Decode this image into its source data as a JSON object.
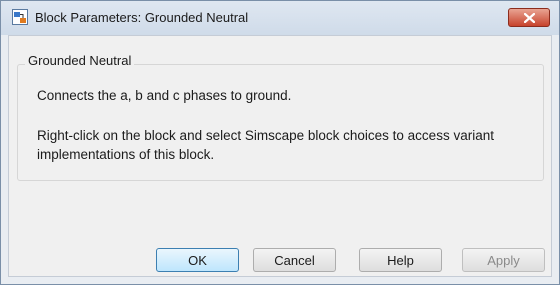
{
  "window": {
    "title": "Block Parameters: Grounded Neutral",
    "app_icon": "simulink-block-icon",
    "close_icon": "close-icon"
  },
  "group": {
    "title": "Grounded Neutral",
    "description_1": "Connects the a, b and c phases to ground.",
    "description_2": "Right-click on the block and select Simscape block choices to access variant implementations of this block."
  },
  "buttons": {
    "ok": "OK",
    "cancel": "Cancel",
    "help": "Help",
    "apply": "Apply"
  },
  "colors": {
    "close_button": "#c7432c",
    "default_button": "#bee6fd",
    "window_border": "#7a8fa8"
  }
}
